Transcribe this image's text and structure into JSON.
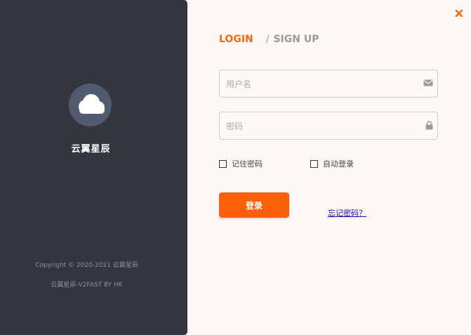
{
  "brand": {
    "name": "云翼星辰",
    "copyright": "Copyright © 2020-2021 云翼星辰",
    "credit": "云翼星辰-V2FAST BY HK",
    "logo_icon": "cloud-icon"
  },
  "tabs": {
    "login": "LOGIN",
    "separator": "/",
    "signup": "SIGN UP"
  },
  "form": {
    "username_placeholder": "用户名",
    "username_value": "",
    "username_icon": "envelope-icon",
    "password_placeholder": "密码",
    "password_value": "",
    "password_icon": "lock-icon",
    "remember_label": "记住密码",
    "remember_checked": false,
    "autologin_label": "自动登录",
    "autologin_checked": false,
    "submit_label": "登录",
    "forgot_label": "忘记密码？"
  },
  "colors": {
    "sidebar": "#33363e",
    "accent": "#fb6008",
    "panel": "#fdf8f6"
  }
}
